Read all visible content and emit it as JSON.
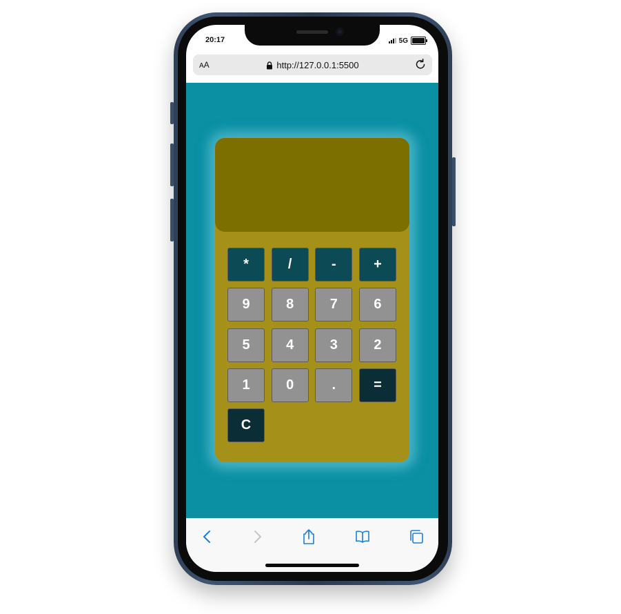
{
  "status_bar": {
    "time": "20:17",
    "network": "5G",
    "signal_icon": "cellular-signal-icon",
    "battery_icon": "battery-icon"
  },
  "browser": {
    "text_size_label_small": "A",
    "text_size_label_large": "A",
    "url": "http://127.0.0.1:5500",
    "lock_icon": "lock-icon",
    "reload_icon": "reload-icon"
  },
  "calculator": {
    "display_value": "",
    "keys": [
      {
        "label": "*",
        "kind": "op"
      },
      {
        "label": "/",
        "kind": "op"
      },
      {
        "label": "-",
        "kind": "op"
      },
      {
        "label": "+",
        "kind": "op"
      },
      {
        "label": "9",
        "kind": "num"
      },
      {
        "label": "8",
        "kind": "num"
      },
      {
        "label": "7",
        "kind": "num"
      },
      {
        "label": "6",
        "kind": "num"
      },
      {
        "label": "5",
        "kind": "num"
      },
      {
        "label": "4",
        "kind": "num"
      },
      {
        "label": "3",
        "kind": "num"
      },
      {
        "label": "2",
        "kind": "num"
      },
      {
        "label": "1",
        "kind": "num"
      },
      {
        "label": "0",
        "kind": "num"
      },
      {
        "label": ".",
        "kind": "num"
      },
      {
        "label": "=",
        "kind": "dark"
      },
      {
        "label": "C",
        "kind": "dark"
      }
    ],
    "colors": {
      "page_background": "#0a8fa3",
      "body": "#a5911a",
      "display": "#7d6e00",
      "operator_key": "#0c4b56",
      "number_key": "#929292",
      "action_key": "#0b2d36"
    }
  },
  "toolbar": {
    "back_icon": "chevron-left-icon",
    "forward_icon": "chevron-right-icon",
    "share_icon": "share-icon",
    "bookmarks_icon": "book-icon",
    "tabs_icon": "tabs-icon",
    "accent_color": "#1a7fd4"
  }
}
